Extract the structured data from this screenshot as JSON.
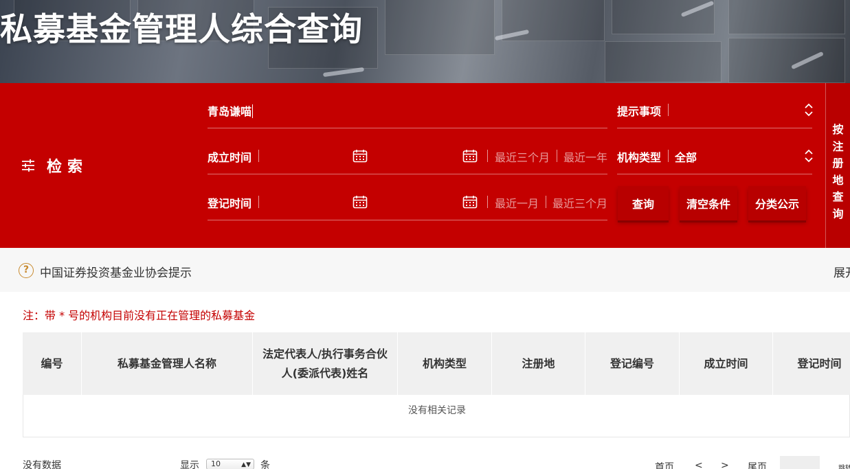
{
  "banner": {
    "title": "私募基金管理人综合查询"
  },
  "search": {
    "panel_label": "检索",
    "keyword_value": "青岛谦喵",
    "hint_label": "提示事项",
    "founded_label": "成立时间",
    "founded_quick_1": "最近三个月",
    "founded_quick_2": "最近一年",
    "org_type_label": "机构类型",
    "org_type_value": "全部",
    "registered_label": "登记时间",
    "registered_quick_1": "最近一月",
    "registered_quick_2": "最近三个月",
    "buttons": {
      "query": "查询",
      "clear": "清空条件",
      "category": "分类公示"
    },
    "side_tab": [
      "按",
      "注",
      "册",
      "地",
      "查",
      "询"
    ]
  },
  "notice": {
    "icon": "question-circle-icon",
    "text": "中国证券投资基金业协会提示",
    "expand": "展开"
  },
  "note": "注：带 * 号的机构目前没有正在管理的私募基金",
  "table": {
    "headers": [
      "编号",
      "私募基金管理人名称",
      "法定代表人/执行事务合伙人(委派代表)姓名",
      "机构类型",
      "注册地",
      "登记编号",
      "成立时间",
      "登记时间"
    ],
    "empty_text": "没有相关记录"
  },
  "footer": {
    "no_data": "没有数据",
    "show_label": "显示",
    "page_size": "10",
    "unit": "条",
    "first": "首页",
    "prev": "<",
    "next": ">",
    "last": "尾页",
    "jump": "跳转"
  },
  "colors": {
    "primary_red": "#c40000",
    "accent_orange": "#c88a2e"
  }
}
